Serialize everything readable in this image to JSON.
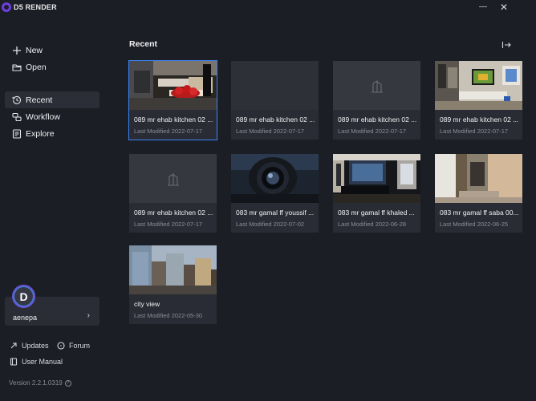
{
  "app": {
    "title": "D5 RENDER"
  },
  "window": {
    "minimize": "—",
    "close": "✕"
  },
  "sidebar": {
    "items": [
      {
        "label": "New",
        "icon": "plus-icon"
      },
      {
        "label": "Open",
        "icon": "folder-icon"
      },
      {
        "label": "Recent",
        "icon": "history-icon",
        "active": true
      },
      {
        "label": "Workflow",
        "icon": "workflow-icon"
      },
      {
        "label": "Explore",
        "icon": "explore-icon"
      }
    ],
    "user": {
      "initial": "D",
      "name": "aenepa",
      "chevron": "›"
    },
    "updates": "Updates",
    "forum": "Forum",
    "manual": "User Manual",
    "version": "Version 2.2.1.0319",
    "help": "?"
  },
  "main": {
    "title": "Recent",
    "projects": [
      {
        "name": "089 mr ehab kitchen 02 ...",
        "date": "Last Modified 2022-07-17",
        "thumb": "kitchen-red"
      },
      {
        "name": "089 mr ehab kitchen 02 ...",
        "date": "Last Modified 2022-07-17",
        "thumb": "empty"
      },
      {
        "name": "089 mr ehab kitchen 02 ...",
        "date": "Last Modified 2022-07-17",
        "thumb": "placeholder"
      },
      {
        "name": "089 mr ehab kitchen 02 ...",
        "date": "Last Modified 2022-07-17",
        "thumb": "kitchen-bright"
      },
      {
        "name": "089 mr ehab kitchen 02 ...",
        "date": "Last Modified 2022-07-17",
        "thumb": "placeholder"
      },
      {
        "name": "083 mr gamal ff youssif ...",
        "date": "Last Modified 2022-07-02",
        "thumb": "lens"
      },
      {
        "name": "083 mr gamal ff khaled ...",
        "date": "Last Modified 2022-06-28",
        "thumb": "bedroom"
      },
      {
        "name": "083 mr gamal ff saba 00...",
        "date": "Last Modified 2022-06-25",
        "thumb": "corridor"
      },
      {
        "name": "city view",
        "date": "Last Modified 2022-05-30",
        "thumb": "city"
      }
    ]
  }
}
